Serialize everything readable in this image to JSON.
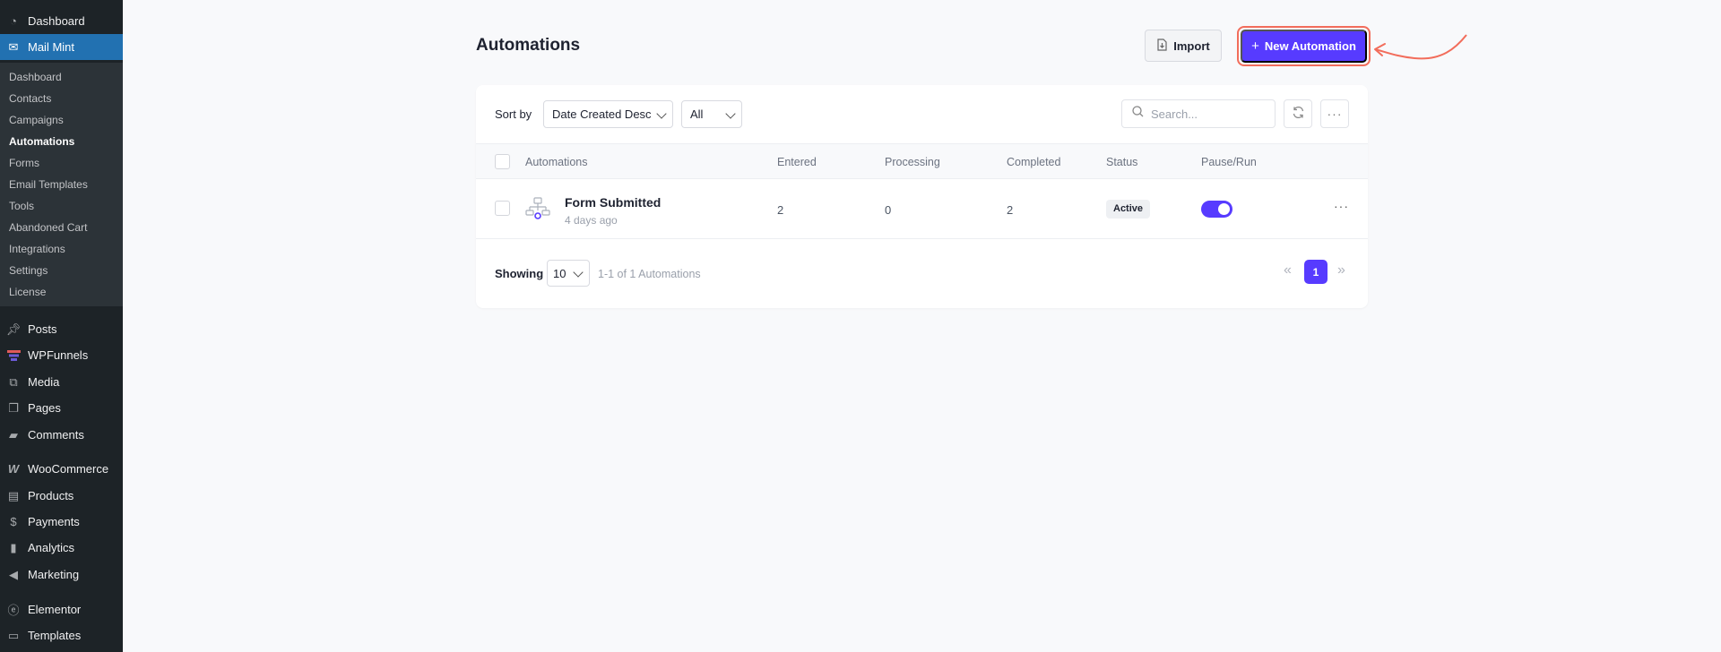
{
  "sidebar": {
    "top_items": [
      {
        "label": "Dashboard",
        "icon": "dashboard-icon"
      },
      {
        "label": "Mail Mint",
        "icon": "mail-icon"
      }
    ],
    "submenu": [
      "Dashboard",
      "Contacts",
      "Campaigns",
      "Automations",
      "Forms",
      "Email Templates",
      "Tools",
      "Abandoned Cart",
      "Integrations",
      "Settings",
      "License"
    ],
    "current_submenu": "Automations",
    "items": [
      {
        "label": "Posts",
        "icon": "pin-icon"
      },
      {
        "label": "WPFunnels",
        "icon": "funnel-icon"
      },
      {
        "label": "Media",
        "icon": "media-icon"
      },
      {
        "label": "Pages",
        "icon": "pages-icon"
      },
      {
        "label": "Comments",
        "icon": "comment-icon"
      },
      {
        "label": "WooCommerce",
        "icon": "woo-icon"
      },
      {
        "label": "Products",
        "icon": "archive-icon"
      },
      {
        "label": "Payments",
        "icon": "payments-icon"
      },
      {
        "label": "Analytics",
        "icon": "bar-chart-icon"
      },
      {
        "label": "Marketing",
        "icon": "megaphone-icon"
      },
      {
        "label": "Elementor",
        "icon": "elementor-icon"
      },
      {
        "label": "Templates",
        "icon": "folder-icon"
      }
    ]
  },
  "header": {
    "title": "Automations",
    "import_label": "Import",
    "new_label": "New Automation"
  },
  "toolbar": {
    "sort_label": "Sort by",
    "sort_value": "Date Created Desc",
    "filter_value": "All",
    "search_placeholder": "Search..."
  },
  "table": {
    "columns": [
      "Automations",
      "Entered",
      "Processing",
      "Completed",
      "Status",
      "Pause/Run"
    ],
    "rows": [
      {
        "name": "Form Submitted",
        "time": "4 days ago",
        "entered": "2",
        "processing": "0",
        "completed": "2",
        "status": "Active",
        "running": true
      }
    ]
  },
  "footer": {
    "showing_label": "Showing",
    "per_page": "10",
    "count_text": "1-1 of 1 Automations",
    "current_page": "1"
  },
  "colors": {
    "accent": "#573bff",
    "highlight": "#f26d5b",
    "sidebar_bg": "#1d2327",
    "active_menu": "#2271b1"
  }
}
